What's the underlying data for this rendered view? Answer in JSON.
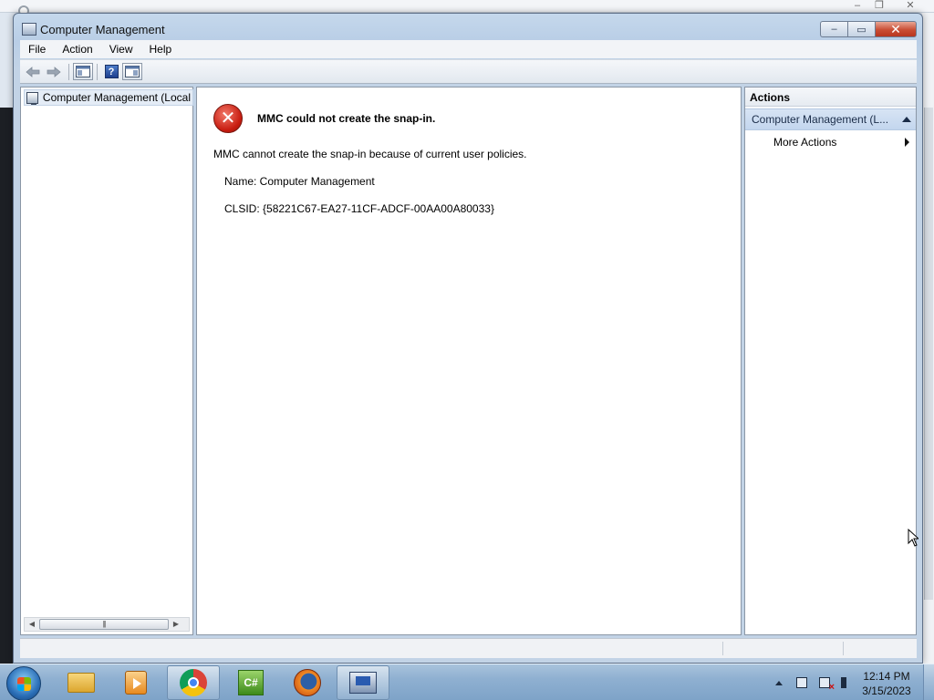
{
  "background": {
    "top_controls": [
      "–",
      "❐",
      "✕"
    ]
  },
  "window": {
    "title": "Computer Management",
    "controls": {
      "minimize": "–",
      "maximize": "▭",
      "close": "✕"
    }
  },
  "menubar": {
    "items": [
      "File",
      "Action",
      "View",
      "Help"
    ]
  },
  "toolbar": {
    "icons": [
      "back-arrow-icon",
      "forward-arrow-icon",
      "show-hide-console-tree-icon",
      "help-icon",
      "show-hide-action-pane-icon"
    ],
    "help_glyph": "?"
  },
  "tree": {
    "root_label": "Computer Management (Local",
    "scroll_thumb_glyph": "|||",
    "scroll_left": "◀",
    "scroll_right": "▶"
  },
  "error": {
    "icon_glyph": "✕",
    "title": "MMC could not create the snap-in.",
    "message": "MMC cannot create the snap-in because of current user policies.",
    "name_line": "Name: Computer Management",
    "clsid_line": "CLSID: {58221C67-EA27-11CF-ADCF-00AA00A80033}"
  },
  "actions": {
    "header": "Actions",
    "group_label": "Computer Management (L...",
    "more_actions": "More Actions"
  },
  "taskbar": {
    "apps": [
      "windows-explorer-icon",
      "media-player-icon",
      "chrome-icon",
      "csharp-icon",
      "firefox-icon",
      "computer-management-icon"
    ],
    "csharp_glyph": "C#",
    "clock_time": "12:14 PM",
    "clock_date": "3/15/2023"
  },
  "colors": {
    "window_frame": "#b9cee6",
    "error_red": "#c81c10",
    "actions_group_bg": "#c3d6ee",
    "taskbar": "#8fb0d1"
  }
}
